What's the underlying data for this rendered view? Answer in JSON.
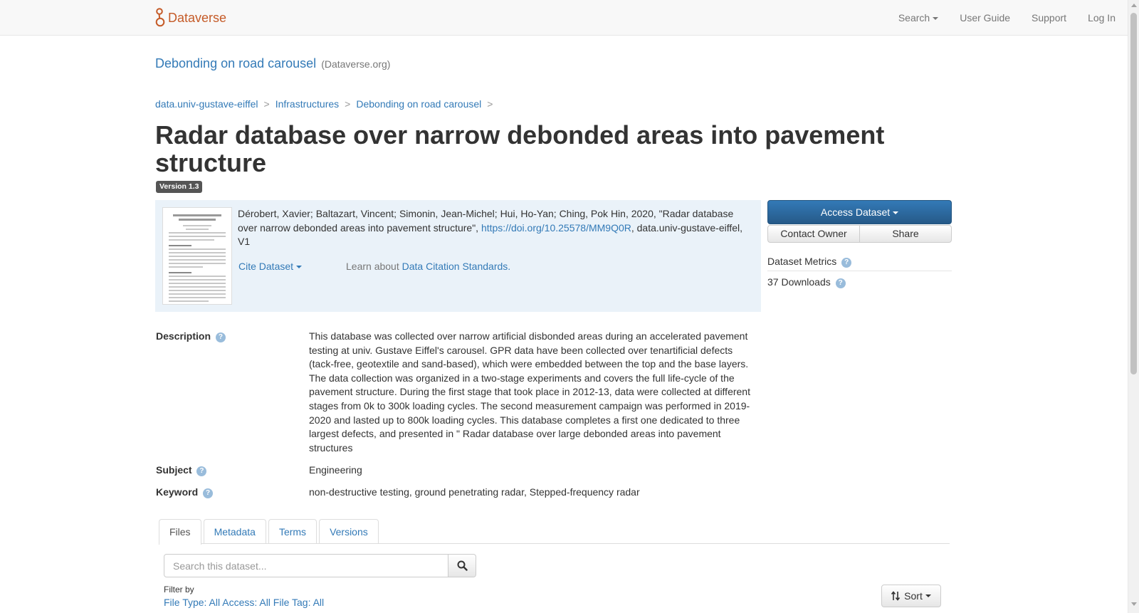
{
  "navbar": {
    "brand": "Dataverse",
    "search": "Search",
    "user_guide": "User Guide",
    "support": "Support",
    "login": "Log In"
  },
  "dataverse": {
    "name": "Debonding on road carousel",
    "affiliation": "(Dataverse.org)"
  },
  "breadcrumb": [
    "data.univ-gustave-eiffel",
    "Infrastructures",
    "Debonding on road carousel"
  ],
  "breadcrumb_separator": ">",
  "dataset": {
    "title": "Radar database over narrow debonded areas into pavement structure",
    "version": "Version 1.3"
  },
  "citation": {
    "text_before": "Dérobert, Xavier; Baltazart, Vincent; Simonin, Jean-Michel; Hui, Ho-Yan; Ching, Pok Hin, 2020, \"Radar database over narrow debonded areas into pavement structure\", ",
    "doi": "https://doi.org/10.25578/MM9Q0R",
    "text_after": ", data.univ-gustave-eiffel, V1",
    "cite_label": "Cite Dataset",
    "learn_prefix": "Learn about ",
    "learn_link": "Data Citation Standards."
  },
  "actions": {
    "access": "Access Dataset",
    "contact": "Contact Owner",
    "share": "Share"
  },
  "metrics": {
    "title": "Dataset Metrics",
    "downloads": "37 Downloads"
  },
  "metadata": {
    "description_label": "Description",
    "description": "This database was collected over narrow artificial disbonded areas during an accelerated pavement testing at univ. Gustave Eiffel's carousel. GPR data have been collected over tenartificial defects (tack-free, geotextile and sand-based), which were embedded between the top and the base layers. The data collection was organized in a two-stage experiments and covers the full life-cycle of the pavement structure. During the first stage that took place in 2012-13, data were collected at different stages from 0k to 300k loading cycles. The second measurement campaign was performed in 2019-2020 and lasted up to 800k loading cycles. This database completes a first one dedicated to three largest defects, and presented in \" Radar database over large debonded areas into pavement structures",
    "subject_label": "Subject",
    "subject": "Engineering",
    "keyword_label": "Keyword",
    "keyword": "non-destructive testing, ground penetrating radar, Stepped-frequency radar"
  },
  "tabs": [
    "Files",
    "Metadata",
    "Terms",
    "Versions"
  ],
  "files": {
    "search_placeholder": "Search this dataset...",
    "filter_label": "Filter by",
    "filter_links": "File Type: All    Access: All    File Tag: All",
    "sort_label": "Sort"
  },
  "colors": {
    "brand": "#c55b28",
    "link": "#337ab7",
    "primary_button": "#337ab7",
    "citation_bg": "#eaf2f9"
  }
}
